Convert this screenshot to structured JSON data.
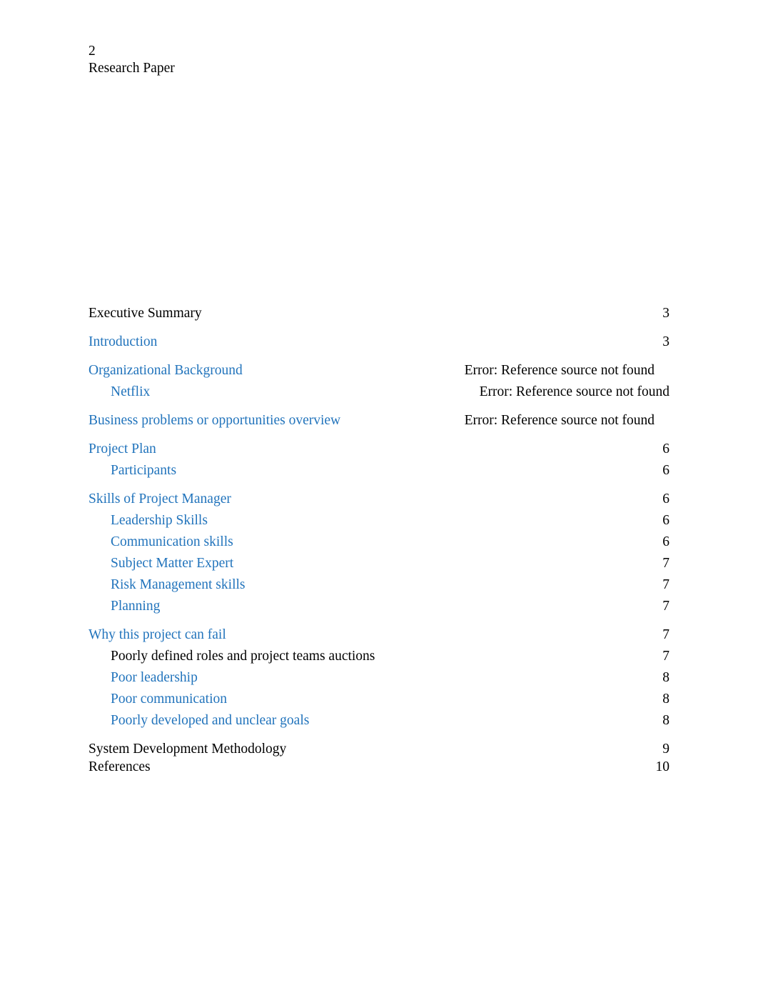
{
  "document": {
    "header": {
      "page_label": "2",
      "title": "Research Paper"
    },
    "toc": {
      "entries": [
        {
          "label": "Executive Summary",
          "page": "3",
          "level": 1,
          "style": "plain",
          "spacing": "none",
          "right_inset": false
        },
        {
          "label": "Introduction",
          "page": "3",
          "level": 1,
          "style": "link",
          "spacing": "major",
          "right_inset": false
        },
        {
          "label": "Organizational Background",
          "page": "Error: Reference source not found",
          "level": 1,
          "style": "link",
          "spacing": "major",
          "right_inset": true
        },
        {
          "label": "Netflix",
          "page": "Error: Reference source not found",
          "level": 2,
          "style": "link",
          "spacing": "minor",
          "right_inset": false
        },
        {
          "label": "Business problems or opportunities overview",
          "page": "Error: Reference source not found",
          "level": 1,
          "style": "link",
          "spacing": "major",
          "right_inset": true
        },
        {
          "label": "Project Plan",
          "page": "6",
          "level": 1,
          "style": "link",
          "spacing": "major",
          "right_inset": false
        },
        {
          "label": "Participants",
          "page": "6",
          "level": 2,
          "style": "link",
          "spacing": "minor",
          "right_inset": false
        },
        {
          "label": "Skills of Project Manager",
          "page": "6",
          "level": 1,
          "style": "link",
          "spacing": "major",
          "right_inset": false
        },
        {
          "label": "Leadership Skills",
          "page": "6",
          "level": 2,
          "style": "link",
          "spacing": "minor",
          "right_inset": false
        },
        {
          "label": "Communication skills",
          "page": "6",
          "level": 2,
          "style": "link",
          "spacing": "minor",
          "right_inset": false
        },
        {
          "label": "Subject Matter Expert",
          "page": "7",
          "level": 2,
          "style": "link",
          "spacing": "minor",
          "right_inset": false
        },
        {
          "label": "Risk Management skills",
          "page": "7",
          "level": 2,
          "style": "link",
          "spacing": "minor",
          "right_inset": false
        },
        {
          "label": "Planning",
          "page": "7",
          "level": 2,
          "style": "link",
          "spacing": "minor",
          "right_inset": false
        },
        {
          "label": "Why this project can fail",
          "page": "7",
          "level": 1,
          "style": "link",
          "spacing": "major",
          "right_inset": false
        },
        {
          "label": "Poorly defined roles and project teams auctions",
          "page": "7",
          "level": 2,
          "style": "plain",
          "spacing": "minor",
          "right_inset": false
        },
        {
          "label": "Poor leadership",
          "page": "8",
          "level": 2,
          "style": "link",
          "spacing": "minor",
          "right_inset": false
        },
        {
          "label": "Poor communication",
          "page": "8",
          "level": 2,
          "style": "link",
          "spacing": "minor",
          "right_inset": false
        },
        {
          "label": "Poorly developed and unclear goals",
          "page": "8",
          "level": 2,
          "style": "link",
          "spacing": "minor",
          "right_inset": false
        },
        {
          "label": "System Development Methodology",
          "page": "9",
          "level": 1,
          "style": "plain",
          "spacing": "major",
          "right_inset": false
        },
        {
          "label": "References",
          "page": "10",
          "level": 1,
          "style": "plain",
          "spacing": "tight",
          "right_inset": false
        }
      ]
    },
    "colors": {
      "hyperlink_blue": "#2274BC",
      "body_text": "#000000",
      "page_background": "#ffffff"
    }
  }
}
